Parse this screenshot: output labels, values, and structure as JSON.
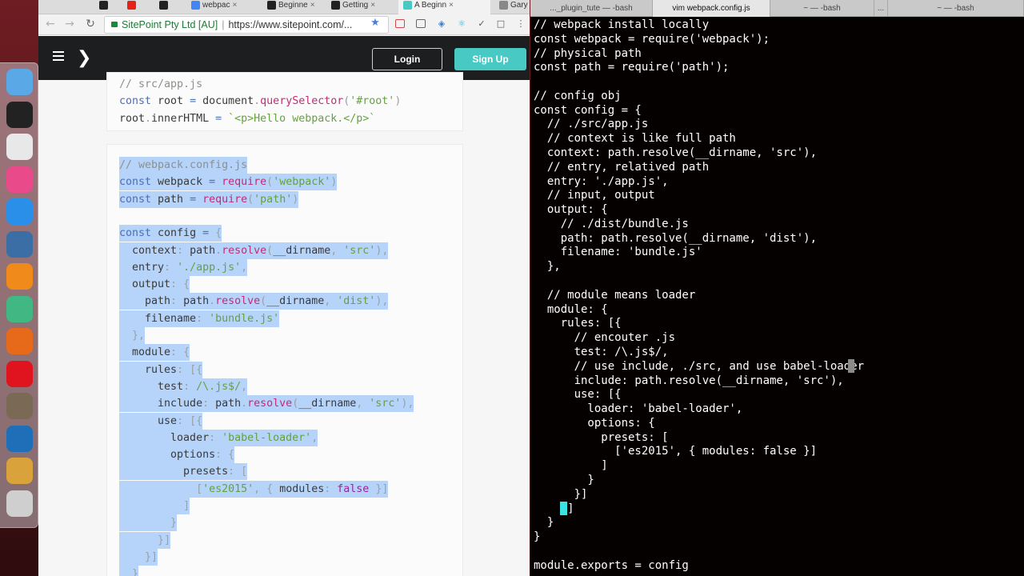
{
  "browser": {
    "tabs": [
      {
        "label": "",
        "icon": "github-icon",
        "color": "#222222"
      },
      {
        "label": "",
        "icon": "youtube-icon",
        "color": "#e62117"
      },
      {
        "label": "",
        "icon": "github-icon",
        "color": "#222222"
      },
      {
        "label": "webpac",
        "icon": "google-icon",
        "color": "#4285f4"
      },
      {
        "label": "Beginne",
        "icon": "medium-icon",
        "color": "#222222"
      },
      {
        "label": "Getting",
        "icon": "medium-icon",
        "color": "#222222"
      },
      {
        "label": "A Beginn",
        "icon": "sitepoint-icon",
        "color": "#48c9c3"
      },
      {
        "label": "Gary",
        "icon": "profile-icon",
        "color": "#888888"
      }
    ],
    "address": {
      "org": "SitePoint Pty Ltd [AU]",
      "url": "https://www.sitepoint.com/..."
    }
  },
  "site": {
    "login_label": "Login",
    "signup_label": "Sign Up",
    "accent": "#48c9c3"
  },
  "article_code": {
    "block1": [
      "// src/app.js",
      "const root = document.querySelector('#root')",
      "root.innerHTML = `<p>Hello webpack.</p>`"
    ],
    "block2": [
      "// webpack.config.js",
      "const webpack = require('webpack')",
      "const path = require('path')",
      "",
      "const config = {",
      "  context: path.resolve(__dirname, 'src'),",
      "  entry: './app.js',",
      "  output: {",
      "    path: path.resolve(__dirname, 'dist'),",
      "    filename: 'bundle.js'",
      "  },",
      "  module: {",
      "    rules: [{",
      "      test: /\\.js$/,",
      "      include: path.resolve(__dirname, 'src'),",
      "      use: [{",
      "        loader: 'babel-loader',",
      "        options: {",
      "          presets: [",
      "            ['es2015', { modules: false }]",
      "          ]",
      "        }",
      "      }]",
      "    }]",
      "  }"
    ]
  },
  "terminal": {
    "tabs": [
      {
        "label": "..._plugin_tute — -bash",
        "active": false
      },
      {
        "label": "vim webpack.config.js",
        "active": true
      },
      {
        "label": "~ — -bash",
        "active": false
      },
      {
        "label": "...",
        "active": false
      },
      {
        "label": "~ — -bash",
        "active": false
      }
    ],
    "lines": [
      "// webpack install locally",
      "const webpack = require('webpack');",
      "// physical path",
      "const path = require('path');",
      "",
      "// config obj",
      "const config = {",
      "  // ./src/app.js",
      "  // context is like full path",
      "  context: path.resolve(__dirname, 'src'),",
      "  // entry, relatived path",
      "  entry: './app.js',",
      "  // input, output",
      "  output: {",
      "    // ./dist/bundle.js",
      "    path: path.resolve(__dirname, 'dist'),",
      "    filename: 'bundle.js'",
      "  },",
      "",
      "  // module means loader",
      "  module: {",
      "    rules: [{",
      "      // encouter .js",
      "      test: /\\.js$/,",
      "      // use include, ./src, and use babel-loader",
      "      include: path.resolve(__dirname, 'src'),",
      "      use: [{",
      "        loader: 'babel-loader',",
      "        options: {",
      "          presets: [",
      "            ['es2015', { modules: false }]",
      "          ]",
      "        }",
      "      }]",
      "    }]",
      "  }",
      "}",
      "",
      "module.exports = config"
    ]
  },
  "dock": {
    "items": [
      {
        "icon": "finder-icon",
        "color": "#5aa9e6"
      },
      {
        "icon": "terminal-icon",
        "color": "#222222"
      },
      {
        "icon": "chrome-icon",
        "color": "#e8e8e8"
      },
      {
        "icon": "itunes-icon",
        "color": "#e84a8a"
      },
      {
        "icon": "app-store-icon",
        "color": "#2a8fe8"
      },
      {
        "icon": "virtualbox-icon",
        "color": "#3a6ea5"
      },
      {
        "icon": "vlc-icon",
        "color": "#f08a1a"
      },
      {
        "icon": "atom-icon",
        "color": "#41b883"
      },
      {
        "icon": "firefox-icon",
        "color": "#e66a1a"
      },
      {
        "icon": "opera-icon",
        "color": "#e0141e"
      },
      {
        "icon": "gimp-icon",
        "color": "#7a6a55"
      },
      {
        "icon": "quicktime-icon",
        "color": "#1e6fb8"
      },
      {
        "icon": "drinks-icon",
        "color": "#d9a23a"
      },
      {
        "icon": "trash-icon",
        "color": "#cfcfcf"
      }
    ]
  }
}
